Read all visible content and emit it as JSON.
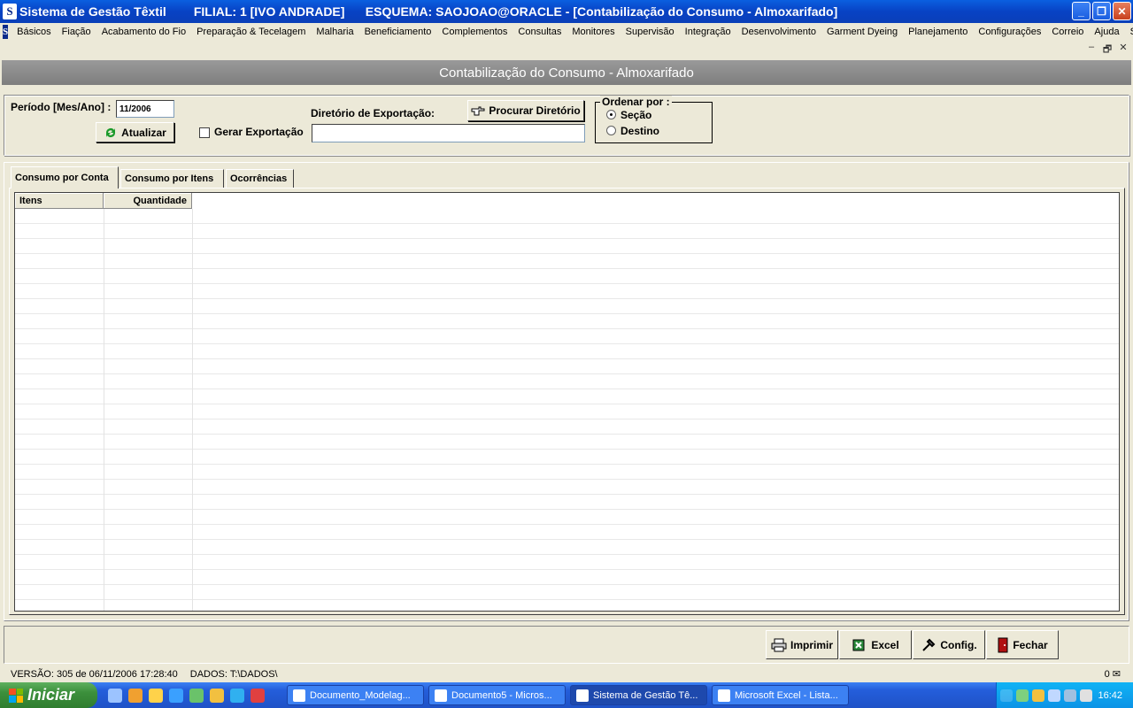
{
  "window": {
    "icon": "S",
    "title": "Sistema de Gestão Têxtil        FILIAL: 1 [IVO ANDRADE]      ESQUEMA: SAOJOAO@ORACLE - [Contabilização do Consumo - Almoxarifado]",
    "minimize": "_",
    "maximize": "❐",
    "close": "✕"
  },
  "menu": [
    "Básicos",
    "Fiação",
    "Acabamento do Fio",
    "Preparação & Tecelagem",
    "Malharia",
    "Beneficiamento",
    "Complementos",
    "Consultas",
    "Monitores",
    "Supervisão",
    "Integração",
    "Desenvolvimento",
    "Garment Dyeing",
    "Planejamento",
    "Configurações",
    "Correio",
    "Ajuda",
    "Sair"
  ],
  "mdi": {
    "min": "–",
    "restore": "🗗",
    "close": "✕"
  },
  "form": {
    "title": "Contabilização do Consumo - Almoxarifado",
    "period_label": "Período [Mes/Ano] :",
    "period_value": "11/2006",
    "refresh_label": "Atualizar",
    "export_check_label": "Gerar Exportação",
    "dir_label": "Diretório de Exportação:",
    "dir_value": "",
    "browse_label": "Procurar Diretório",
    "order_legend": "Ordenar por :",
    "order_options": [
      "Seção",
      "Destino"
    ],
    "order_selected": "Seção"
  },
  "tabs": [
    "Consumo por Conta",
    "Consumo por Itens",
    "Ocorrências"
  ],
  "grid": {
    "columns": [
      "Itens",
      "Quantidade"
    ],
    "rows": []
  },
  "buttons": {
    "print": "Imprimir",
    "excel": "Excel",
    "config": "Config.",
    "close": "Fechar"
  },
  "status": {
    "version": "VERSÃO: 305 de 06/11/2006 17:28:40",
    "data": "DADOS: T:\\DADOS\\",
    "mail_count": "0"
  },
  "taskbar": {
    "start": "Iniciar",
    "tasks": [
      "Documento_Modelag...",
      "Documento5 - Micros...",
      "Sistema de Gestão Tê...",
      "Microsoft Excel - Lista..."
    ],
    "clock": "16:42"
  }
}
